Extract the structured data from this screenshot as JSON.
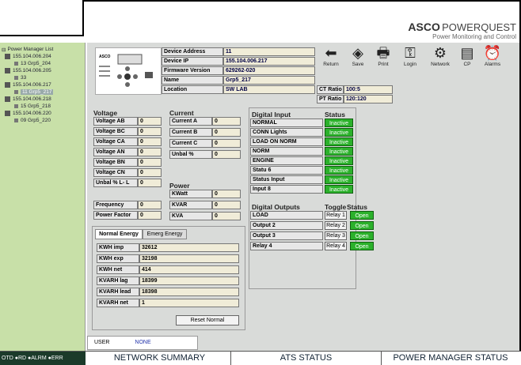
{
  "logo": {
    "brand": "ASCO",
    "brand2": "POWERQUEST",
    "sub": "Power Monitoring and Control"
  },
  "tree": {
    "root": "Power Manager List",
    "items": [
      {
        "label": "155.104.006.204",
        "level": 1
      },
      {
        "label": "13 Grp5_204",
        "level": 2
      },
      {
        "label": "155.104.006.205",
        "level": 1
      },
      {
        "label": "33",
        "level": 2
      },
      {
        "label": "155.104.006.217",
        "level": 1
      },
      {
        "label": "11 Grp5_217",
        "level": 2,
        "selected": true
      },
      {
        "label": "155.104.006.218",
        "level": 1
      },
      {
        "label": "15 Grp5_218",
        "level": 2
      },
      {
        "label": "155.104.006.220",
        "level": 1
      },
      {
        "label": "09 Grp5_220",
        "level": 2
      }
    ]
  },
  "device": {
    "labels": [
      "Device Address",
      "Device IP",
      "Firmware Version",
      "Name",
      "Location"
    ],
    "values": [
      "11",
      "155.104.006.217",
      "629262-020",
      "Grp5_217",
      "SW LAB"
    ],
    "ct_label": "CT Ratio",
    "ct_value": "100:5",
    "pt_label": "PT Ratio",
    "pt_value": "120:120"
  },
  "toolbar": [
    {
      "label": "Return",
      "icon": "arrow-left-icon",
      "glyph": "⬅"
    },
    {
      "label": "Save",
      "icon": "save-icon",
      "glyph": "◈"
    },
    {
      "label": "Print",
      "icon": "print-icon",
      "glyph": "🖶"
    },
    {
      "label": "Login",
      "icon": "login-icon",
      "glyph": "⚿"
    },
    {
      "label": "Network",
      "icon": "network-icon",
      "glyph": "⚙"
    },
    {
      "label": "CP",
      "icon": "cp-icon",
      "glyph": "▤"
    },
    {
      "label": "Alarms",
      "icon": "alarm-clock-icon",
      "glyph": "⏰"
    }
  ],
  "voltage": {
    "title": "Voltage",
    "rows": [
      {
        "label": "Voltage AB",
        "value": "0"
      },
      {
        "label": "Voltage BC",
        "value": "0"
      },
      {
        "label": "Voltage CA",
        "value": "0"
      },
      {
        "label": "Voltage AN",
        "value": "0"
      },
      {
        "label": "Voltage BN",
        "value": "0"
      },
      {
        "label": "Voltage CN",
        "value": "0"
      },
      {
        "label": "Unbal % L- L",
        "value": "0"
      }
    ],
    "freq_label": "Frequency",
    "freq_value": "0",
    "pf_label": "Power Factor",
    "pf_value": "0"
  },
  "current": {
    "title": "Current",
    "rows": [
      {
        "label": "Current A",
        "value": "0"
      },
      {
        "label": "Current B",
        "value": "0"
      },
      {
        "label": "Current C",
        "value": "0"
      },
      {
        "label": "Unbal %",
        "value": "0"
      }
    ]
  },
  "power": {
    "title": "Power",
    "rows": [
      {
        "label": "KWatt",
        "value": "0"
      },
      {
        "label": "KVAR",
        "value": "0"
      },
      {
        "label": "KVA",
        "value": "0"
      }
    ]
  },
  "digital_input": {
    "title": "Digital Input",
    "status_title": "Status",
    "rows": [
      {
        "label": "NORMAL",
        "status": "Inactive"
      },
      {
        "label": "CONN Lights",
        "status": "Inactive"
      },
      {
        "label": "LOAD ON NORM",
        "status": "Inactive"
      },
      {
        "label": "NORM",
        "status": "Inactive"
      },
      {
        "label": "ENGINE",
        "status": "Inactive"
      },
      {
        "label": "Statu 6",
        "status": "Inactive"
      },
      {
        "label": "Status Input",
        "status": "Inactive"
      },
      {
        "label": "Input 8",
        "status": "Inactive"
      }
    ]
  },
  "digital_output": {
    "title": "Digital Outputs",
    "toggle_title": "Toggle",
    "status_title": "Status",
    "rows": [
      {
        "label": "LOAD",
        "toggle": "Relay 1",
        "status": "Open"
      },
      {
        "label": "Output 2",
        "toggle": "Relay 2",
        "status": "Open"
      },
      {
        "label": "Output 3",
        "toggle": "Relay 3",
        "status": "Open"
      },
      {
        "label": "Relay 4",
        "toggle": "Relay 4",
        "status": "Open"
      }
    ]
  },
  "energy": {
    "tabs": [
      "Normal Energy",
      "Emerg Energy"
    ],
    "rows": [
      {
        "label": "KWH imp",
        "value": "32612"
      },
      {
        "label": "KWH exp",
        "value": "32198"
      },
      {
        "label": "KWH net",
        "value": "414"
      },
      {
        "label": "KVARH lag",
        "value": "18399"
      },
      {
        "label": "KVARH lead",
        "value": "18398"
      },
      {
        "label": "KVARH net",
        "value": "1"
      }
    ],
    "reset_label": "Reset Normal"
  },
  "user": {
    "label": "USER",
    "value": "NONE"
  },
  "legend": "OTD ●RD ●ALRM ●ERR",
  "bottom_tabs": [
    "NETWORK SUMMARY",
    "ATS STATUS",
    "POWER MANAGER STATUS"
  ],
  "colors": {
    "status_green": "#2bb12b",
    "tree_bg": "#c8e0a8",
    "panel_bg": "#d9dbd9"
  }
}
